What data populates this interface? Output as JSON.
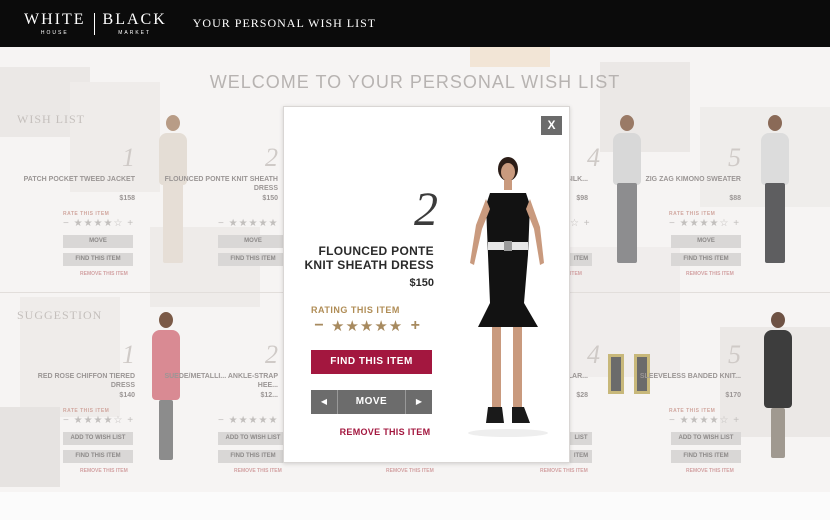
{
  "header": {
    "logo_left": "WHITE",
    "logo_left_sub": "HOUSE",
    "logo_right": "BLACK",
    "logo_right_sub": "MARKET",
    "title": "YOUR PERSONAL WISH LIST"
  },
  "page": {
    "welcome": "WELCOME TO YOUR PERSONAL WISH LIST",
    "wishlist_label": "WISH LIST",
    "suggestion_label": "SUGGESTION"
  },
  "wishlist": [
    {
      "num": "1",
      "name": "PATCH POCKET TWEED JACKET",
      "price": "$158",
      "rating_label": "RATE THIS ITEM",
      "move": "MOVE",
      "find": "FIND THIS ITEM",
      "remove": "REMOVE THIS ITEM"
    },
    {
      "num": "2",
      "name": "FLOUNCED PONTE KNIT SHEATH DRESS",
      "price": "$150",
      "rating_label": "RATING THIS ITEM",
      "move": "MOVE",
      "find": "FIND THIS ITEM",
      "remove": "REMOVE THIS ITEM"
    },
    {
      "num": "4",
      "name": "LEEVE SILK...",
      "price": "$98",
      "rating_label": "",
      "move": "",
      "find": "ITEM",
      "remove": "ITEM"
    },
    {
      "num": "5",
      "name": "ZIG ZAG KIMONO SWEATER",
      "price": "$88",
      "rating_label": "RATE THIS ITEM",
      "move": "MOVE",
      "find": "FIND THIS ITEM",
      "remove": "REMOVE THIS ITEM"
    }
  ],
  "suggestions": [
    {
      "num": "1",
      "name": "RED ROSE CHIFFON TIERED DRESS",
      "price": "$140",
      "rating_label": "RATE THIS ITEM",
      "add": "ADD TO WISH LIST",
      "find": "FIND THIS ITEM",
      "remove": "REMOVE THIS ITEM"
    },
    {
      "num": "2",
      "name": "SUEDE/METALLI... ANKLE-STRAP HEE...",
      "price": "$12...",
      "rating_label": "",
      "add": "ADD TO WISH LIST",
      "find": "FIND THIS ITEM",
      "remove": "REMOVE THIS ITEM"
    },
    {
      "num": "4",
      "name": "BLACK ...ULAR...",
      "price": "$28",
      "rating_label": "",
      "add": "LIST",
      "find": "ITEM",
      "remove": "REMOVE THIS ITEM"
    },
    {
      "num": "5",
      "name": "SLEEVELESS BANDED KNIT...",
      "price": "$170",
      "rating_label": "RATE THIS ITEM",
      "add": "ADD TO WISH LIST",
      "find": "FIND THIS ITEM",
      "remove": "REMOVE THIS ITEM"
    }
  ],
  "middle_remove": "REMOVE THIS ITEM",
  "modal": {
    "close": "X",
    "num": "2",
    "name": "FLOUNCED PONTE KNIT SHEATH DRESS",
    "price": "$150",
    "rating_label": "RATING THIS ITEM",
    "rating_stars": 5,
    "minus": "−",
    "plus": "+",
    "find": "FIND THIS ITEM",
    "move": "MOVE",
    "remove": "REMOVE THIS ITEM"
  },
  "colors": {
    "header_bg": "#0b0b0b",
    "accent": "#a3173f",
    "gold": "#a78a5f",
    "move_gray": "#6c6c6c"
  }
}
